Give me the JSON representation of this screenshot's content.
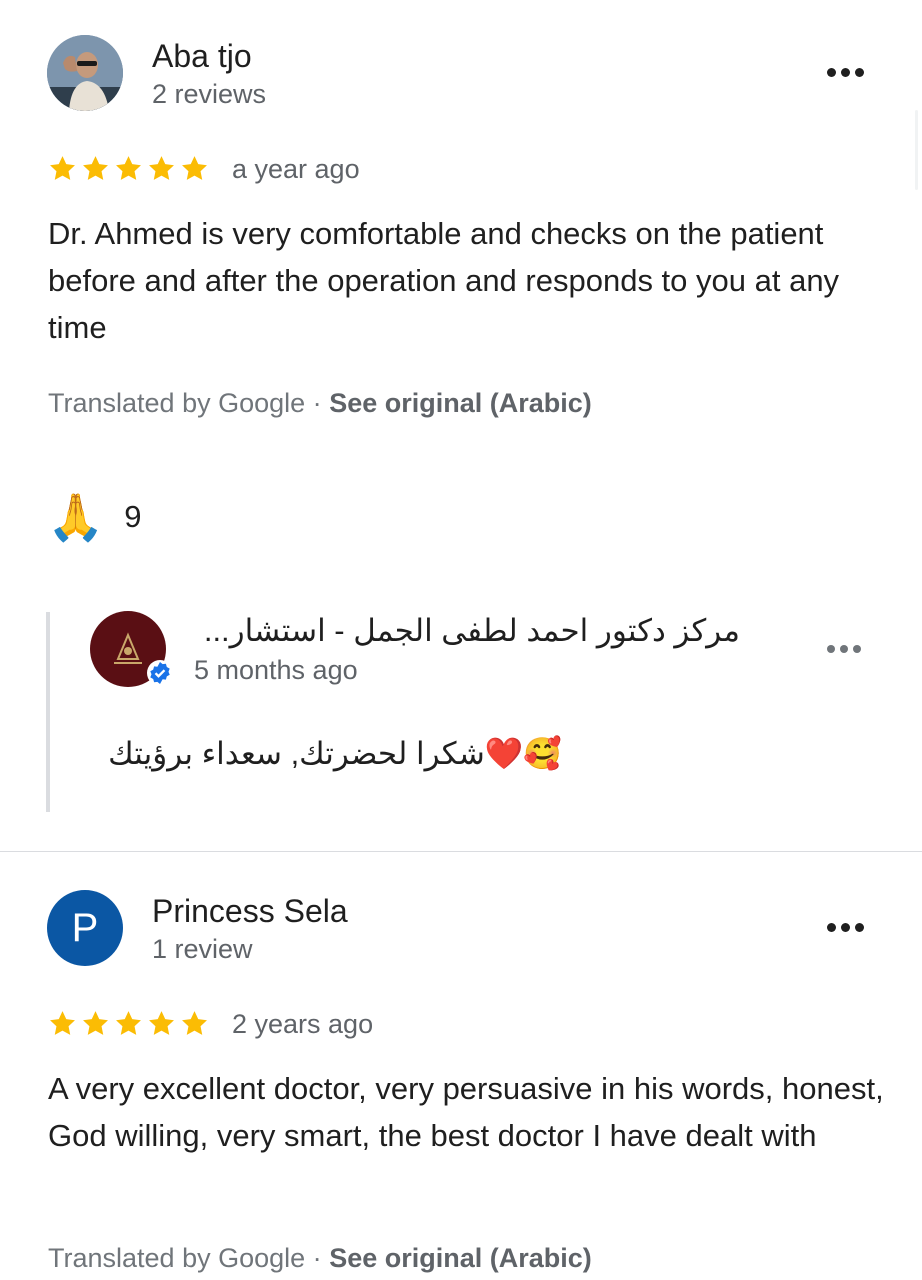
{
  "reviews": [
    {
      "author": "Aba tjo",
      "review_count": "2 reviews",
      "rating": 5,
      "time": "a year ago",
      "text": "Dr. Ahmed is very comfortable and checks on the patient before and after the operation and responds to you at any time",
      "translated_label": "Translated by Google",
      "separator": "·",
      "see_original": "See original (Arabic)",
      "reaction_emoji": "🙏",
      "reaction_count": "9",
      "reply": {
        "owner_name": "مركز دكتور احمد لطفى الجمل - استشار...",
        "time": "5 months ago",
        "text": "🥰❤️شكرا لحضرتك, سعداء برؤيتك"
      }
    },
    {
      "author": "Princess Sela",
      "avatar_letter": "P",
      "review_count": "1 review",
      "rating": 5,
      "time": "2 years ago",
      "text": "A very excellent doctor, very persuasive in his words, honest, God willing, very smart, the best doctor I have dealt with",
      "translated_label": "Translated by Google",
      "separator": "·",
      "see_original": "See original (Arabic)"
    }
  ],
  "colors": {
    "star": "#fbbc04",
    "avatar_blue": "#0b57a4",
    "owner_avatar": "#5a0f14",
    "verified": "#1a73e8",
    "divider": "#dadce0"
  },
  "icons": {
    "more": "more-horizontal-icon",
    "star": "star-icon",
    "verified": "verified-badge-icon",
    "reaction": "folded-hands-emoji"
  }
}
